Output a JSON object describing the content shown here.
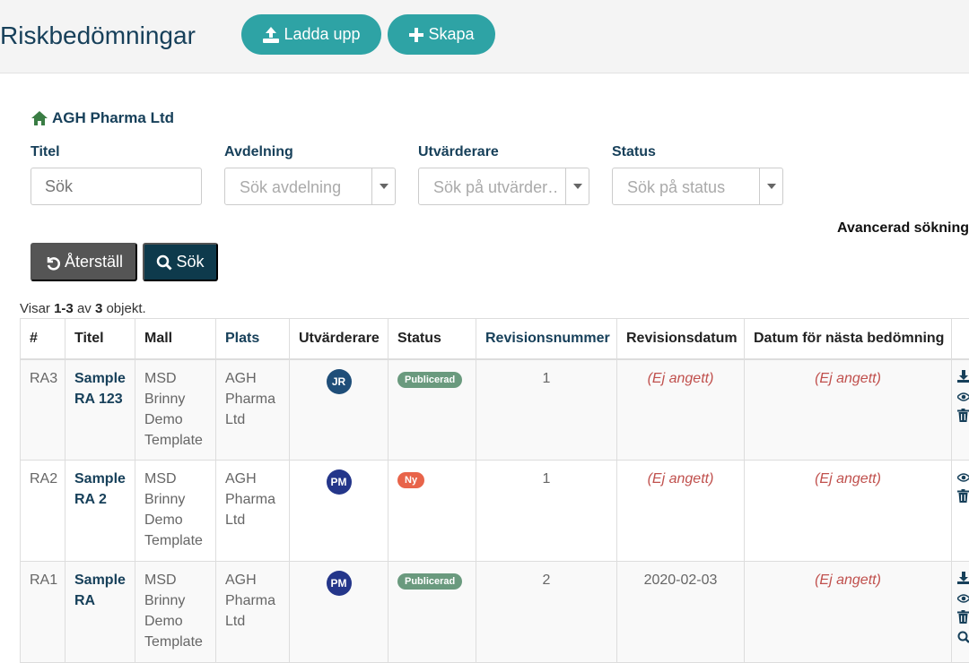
{
  "header": {
    "title": "Riskbedömningar",
    "upload_label": "Ladda upp",
    "create_label": "Skapa",
    "accent": "#2ea3a5"
  },
  "company": {
    "name": "AGH Pharma Ltd",
    "icon": "home-icon"
  },
  "filters": {
    "title": {
      "label": "Titel",
      "placeholder": "Sök"
    },
    "department": {
      "label": "Avdelning",
      "placeholder": "Sök avdelning"
    },
    "assessor": {
      "label": "Utvärderare",
      "placeholder": "Sök på utvärder…"
    },
    "status": {
      "label": "Status",
      "placeholder": "Sök på status"
    },
    "advanced_label": "Avancerad sökning",
    "reset_label": "Återställ",
    "search_label": "Sök"
  },
  "summary": {
    "prefix": "Visar",
    "range": "1-3",
    "middle": "av",
    "total": "3",
    "suffix": "objekt."
  },
  "table": {
    "columns": [
      "#",
      "Titel",
      "Mall",
      "Plats",
      "Utvärderare",
      "Status",
      "Revisionsnummer",
      "Revisionsdatum",
      "Datum för nästa bedömning"
    ],
    "rows": [
      {
        "id": "RA3",
        "title": "Sample RA 123",
        "template": "MSD Brinny Demo Template",
        "site": "AGH Pharma Ltd",
        "assessor": "JR",
        "assessor_color": "#1f4e79",
        "status": "Publicerad",
        "status_color": "#6a9a7e",
        "revision": "1",
        "revision_date": "(Ej angett)",
        "next_date": "(Ej angett)",
        "actions": [
          "download-icon",
          "eye-icon",
          "trash-icon"
        ]
      },
      {
        "id": "RA2",
        "title": "Sample RA 2",
        "template": "MSD Brinny Demo Template",
        "site": "AGH Pharma Ltd",
        "assessor": "PM",
        "assessor_color": "#24368a",
        "status": "Ny",
        "status_color": "#e8644a",
        "revision": "1",
        "revision_date": "(Ej angett)",
        "next_date": "(Ej angett)",
        "actions": [
          "eye-icon",
          "trash-icon"
        ]
      },
      {
        "id": "RA1",
        "title": "Sample RA",
        "template": "MSD Brinny Demo Template",
        "site": "AGH Pharma Ltd",
        "assessor": "PM",
        "assessor_color": "#24368a",
        "status": "Publicerad",
        "status_color": "#6a9a7e",
        "revision": "2",
        "revision_date": "2020-02-03",
        "next_date": "(Ej angett)",
        "actions": [
          "download-icon",
          "eye-icon",
          "trash-icon",
          "search-icon"
        ]
      }
    ]
  }
}
